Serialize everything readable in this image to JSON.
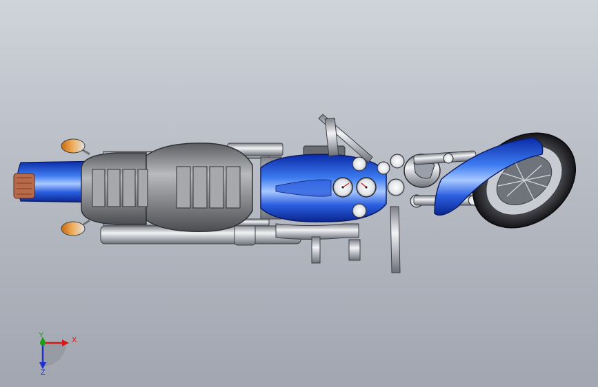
{
  "viewport": {
    "model_name": "motorcycle-top-view",
    "view_orientation": "top",
    "colors": {
      "background_top": "#cfd3da",
      "background_bottom": "#a1a6b0",
      "body_blue": "#1f4fd6",
      "chrome": "#c9ccd2",
      "tire": "#2a2a2e",
      "seat": "#8e9094",
      "turn_signal": "#e08a2a"
    }
  },
  "triad": {
    "x_label": "X",
    "y_label": "Y",
    "z_label": "Z",
    "x_color": "#d81818",
    "y_color": "#18a018",
    "z_color": "#2030d0"
  },
  "gauges": {
    "speedometer": "speedometer-dial",
    "tachometer": "tachometer-dial"
  }
}
